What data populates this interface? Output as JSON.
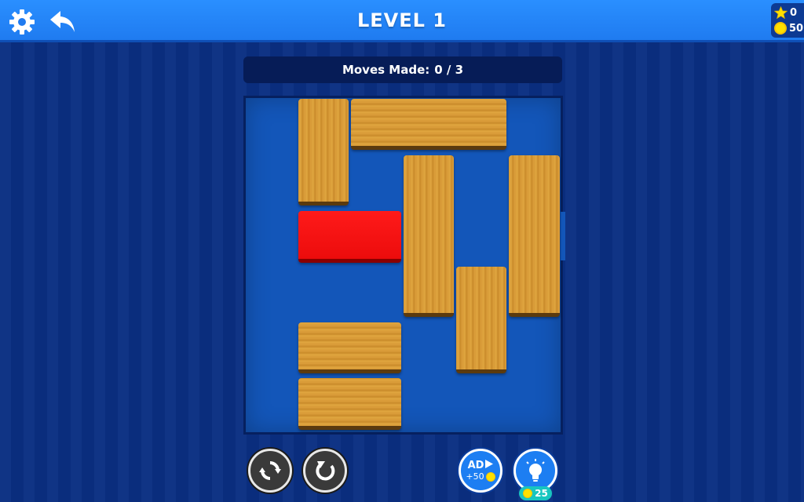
{
  "header": {
    "title": "LEVEL 1",
    "settings_icon": "gear-icon",
    "back_icon": "undo-arrow-icon"
  },
  "wallet": {
    "stars": "0",
    "coins": "50"
  },
  "moves": {
    "label": "Moves Made:",
    "value": "0 / 3"
  },
  "controls": {
    "reset_icon": "refresh-icon",
    "undo_icon": "undo-circle-icon",
    "ad_label": "AD",
    "ad_reward": "+50",
    "hint_icon": "lightbulb-icon",
    "hint_cost": "25"
  },
  "colors": {
    "topbar": "#1f7bf0",
    "background": "#0a2f82",
    "board": "#1356b9",
    "target_block": "#ff1a1a",
    "wood_block": "#d79a36",
    "coin": "#ffe100"
  }
}
